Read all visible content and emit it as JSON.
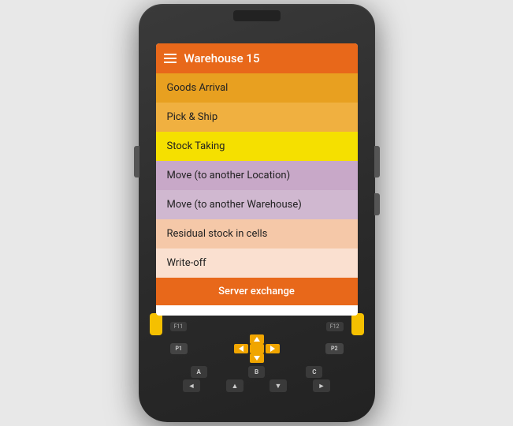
{
  "header": {
    "title": "Warehouse 15",
    "menu_icon": "hamburger"
  },
  "menu_items": [
    {
      "id": "goods-arrival",
      "label": "Goods Arrival",
      "bg": "#e8a020",
      "color": "#222"
    },
    {
      "id": "pick-ship",
      "label": "Pick & Ship",
      "bg": "#f0b040",
      "color": "#222"
    },
    {
      "id": "stock-taking",
      "label": "Stock Taking",
      "bg": "#f5e000",
      "color": "#222"
    },
    {
      "id": "move-location",
      "label": "Move (to another Location)",
      "bg": "#c8a8c8",
      "color": "#222"
    },
    {
      "id": "move-warehouse",
      "label": "Move (to another Warehouse)",
      "bg": "#d0b8d0",
      "color": "#222"
    },
    {
      "id": "residual-stock",
      "label": "Residual stock in cells",
      "bg": "#f5c8a8",
      "color": "#222"
    },
    {
      "id": "write-off",
      "label": "Write-off",
      "bg": "#fae0d0",
      "color": "#222"
    }
  ],
  "server_exchange_btn": {
    "label": "Server exchange",
    "bg": "#e8681a",
    "color": "#fff"
  },
  "bottom_keys": {
    "fn_left": "F11",
    "fn_right": "F12",
    "p1": "P1",
    "p2": "P2",
    "abc_keys": [
      "A",
      "B",
      "C"
    ],
    "arrow_keys": [
      "◄",
      "▲",
      "▼",
      "►"
    ]
  }
}
